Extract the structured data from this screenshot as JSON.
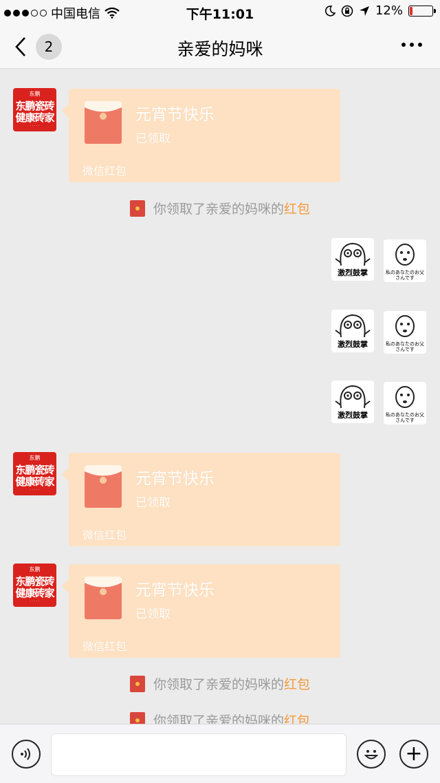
{
  "status_bar": {
    "carrier": "中国电信",
    "time": "下午11:01",
    "battery": "12%",
    "battery_level": 0.12,
    "battery_color": "#e0312c"
  },
  "nav": {
    "back_icon": "chevron-left-icon",
    "unread_count": "2",
    "title": "亲爱的妈咪",
    "more_icon": "more-dots-icon"
  },
  "avatar": {
    "brand_top": "东鹏",
    "line1": "东鹏瓷砖",
    "line2": "健康砖家"
  },
  "red_packet": {
    "title": "元宵节快乐",
    "status": "已领取",
    "footer": "微信红包",
    "bg_color": "#fde1c2"
  },
  "system_message": {
    "prefix": "你领取了亲爱的妈咪的",
    "link": "红包",
    "link_color": "#f49a3c"
  },
  "stickers": {
    "clap_caption": "激烈鼓掌",
    "dad_caption": "私のあなたのお父さんです"
  },
  "input_bar": {
    "voice_icon": "voice-icon",
    "emoji_icon": "emoji-icon",
    "plus_icon": "plus-icon",
    "plus_glyph": "+"
  }
}
